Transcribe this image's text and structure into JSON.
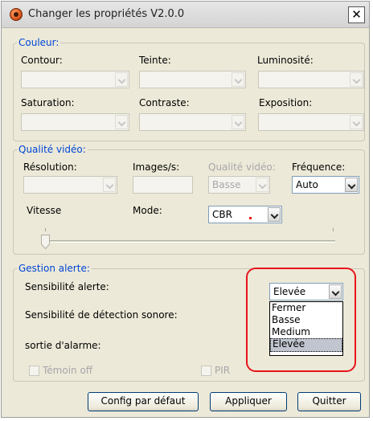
{
  "window": {
    "title": "Changer les propriétés V2.0.0",
    "close_symbol": "✕"
  },
  "couleur": {
    "legend": "Couleur:",
    "contour_label": "Contour:",
    "teinte_label": "Teinte:",
    "luminosite_label": "Luminosité:",
    "saturation_label": "Saturation:",
    "contraste_label": "Contraste:",
    "exposition_label": "Exposition:"
  },
  "video": {
    "legend": "Qualité vidéo:",
    "resolution_label": "Résolution:",
    "images_label": "Images/s:",
    "qualite_label": "Qualité vidéo:",
    "qualite_value": "Basse",
    "frequence_label": "Fréquence:",
    "frequence_value": "Auto",
    "vitesse_label": "Vitesse",
    "mode_label": "Mode:",
    "mode_value": "CBR",
    "vitesse_level": 0
  },
  "alerte": {
    "legend": "Gestion alerte:",
    "sensibilite_label": "Sensibilité alerte:",
    "sensibilite_value": "Elevée",
    "sonore_label": "Sensibilité de détection sonore:",
    "sortie_label": "sortie d'alarme:",
    "dropdown_options": [
      "Fermer",
      "Basse",
      "Medium",
      "Elevée"
    ],
    "temoin_label": "Témoin off",
    "pir_label": "PIR"
  },
  "buttons": {
    "defaults": "Config par défaut",
    "apply": "Appliquer",
    "quit": "Quitter"
  },
  "colors": {
    "accent": "#0046d5",
    "highlight": "#e8131b"
  }
}
